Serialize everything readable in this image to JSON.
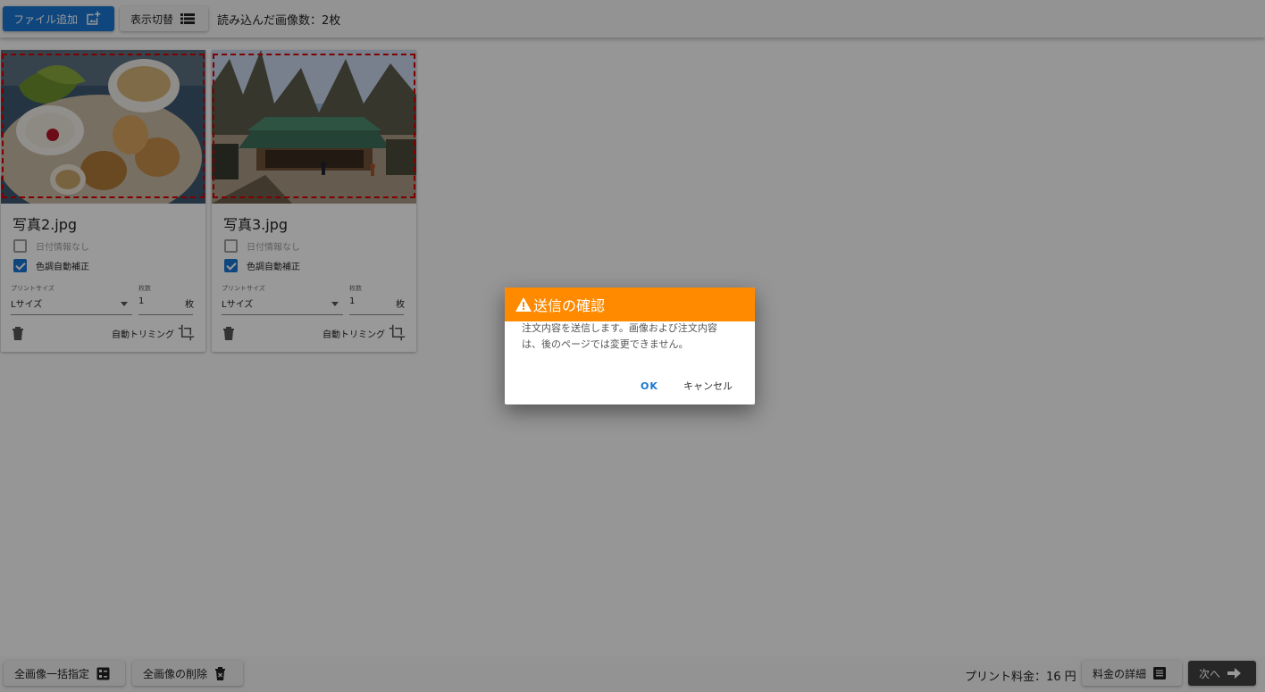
{
  "toolbar": {
    "add_file_label": "ファイル追加",
    "toggle_view_label": "表示切替",
    "loaded_count": "読み込んだ画像数：2枚"
  },
  "cards": [
    {
      "filename": "写真2.jpg",
      "no_date_label": "日付情報なし",
      "no_date_checked": false,
      "auto_color_label": "色調自動補正",
      "auto_color_checked": true,
      "print_size_label": "プリントサイズ",
      "print_size_value": "Lサイズ",
      "quantity_label": "枚数",
      "quantity_value": "1",
      "quantity_unit": "枚",
      "auto_trim_label": "自動トリミング"
    },
    {
      "filename": "写真3.jpg",
      "no_date_label": "日付情報なし",
      "no_date_checked": false,
      "auto_color_label": "色調自動補正",
      "auto_color_checked": true,
      "print_size_label": "プリントサイズ",
      "print_size_value": "Lサイズ",
      "quantity_label": "枚数",
      "quantity_value": "1",
      "quantity_unit": "枚",
      "auto_trim_label": "自動トリミング"
    }
  ],
  "dialog": {
    "title": "送信の確認",
    "message": "注文内容を送信します。画像および注文内容は、後のページでは変更できません。",
    "ok_label": "OK",
    "cancel_label": "キャンセル"
  },
  "bottombar": {
    "select_all_label": "全画像一括指定",
    "delete_all_label": "全画像の削除",
    "print_price": "プリント料金：16 円",
    "price_detail_label": "料金の詳細",
    "next_label": "次へ"
  },
  "colors": {
    "primary": "#1976d2",
    "dialog_header": "#ff8a00",
    "crop_dash": "#d50000"
  }
}
